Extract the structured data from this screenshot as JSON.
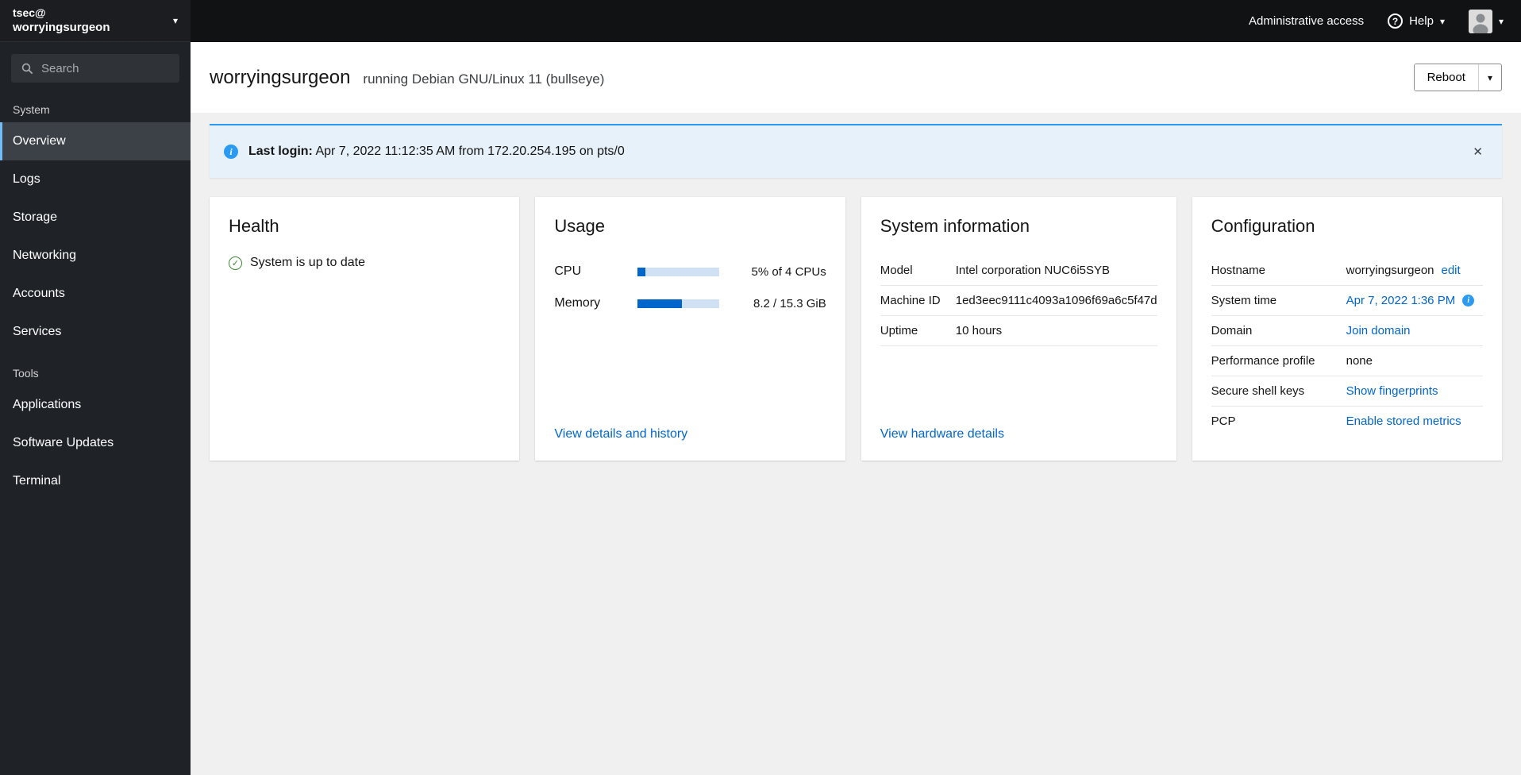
{
  "masthead": {
    "admin_access_label": "Administrative access",
    "help_label": "Help"
  },
  "sidebar": {
    "user": "tsec@",
    "host": "worryingsurgeon",
    "search_placeholder": "Search",
    "system_section_label": "System",
    "tools_section_label": "Tools",
    "system_items": [
      "Overview",
      "Logs",
      "Storage",
      "Networking",
      "Accounts",
      "Services"
    ],
    "tools_items": [
      "Applications",
      "Software Updates",
      "Terminal"
    ]
  },
  "header": {
    "hostname": "worryingsurgeon",
    "os": "running Debian GNU/Linux 11 (bullseye)",
    "reboot_label": "Reboot"
  },
  "alert": {
    "title": "Last login:",
    "message": "Apr 7, 2022 11:12:35 AM from 172.20.254.195 on pts/0"
  },
  "health": {
    "title": "Health",
    "status": "System is up to date"
  },
  "usage": {
    "title": "Usage",
    "rows": [
      {
        "label": "CPU",
        "percent": 5,
        "value": "5% of 4 CPUs"
      },
      {
        "label": "Memory",
        "percent": 54,
        "value": "8.2 / 15.3 GiB"
      }
    ],
    "link": "View details and history"
  },
  "system_info": {
    "title": "System information",
    "rows": [
      {
        "label": "Model",
        "value": "Intel corporation NUC6i5SYB"
      },
      {
        "label": "Machine ID",
        "value": "1ed3eec9111c4093a1096f69a6c5f47d"
      },
      {
        "label": "Uptime",
        "value": "10 hours"
      }
    ],
    "link": "View hardware details"
  },
  "configuration": {
    "title": "Configuration",
    "rows": [
      {
        "label": "Hostname",
        "value": "worryingsurgeon",
        "link": "edit"
      },
      {
        "label": "System time",
        "link": "Apr 7, 2022 1:36 PM"
      },
      {
        "label": "Domain",
        "link": "Join domain"
      },
      {
        "label": "Performance profile",
        "value": "none"
      },
      {
        "label": "Secure shell keys",
        "link": "Show fingerprints"
      },
      {
        "label": "PCP",
        "link": "Enable stored metrics"
      }
    ]
  },
  "icons": {
    "caret_down": "▾",
    "close": "✕",
    "check": "✓",
    "info": "i",
    "question": "?"
  },
  "colors": {
    "link": "#0066cc",
    "info_accent": "#2b9af3",
    "success": "#3e8635",
    "progress_fill": "#0066cc",
    "nav_active_accent": "#73bcf7"
  }
}
